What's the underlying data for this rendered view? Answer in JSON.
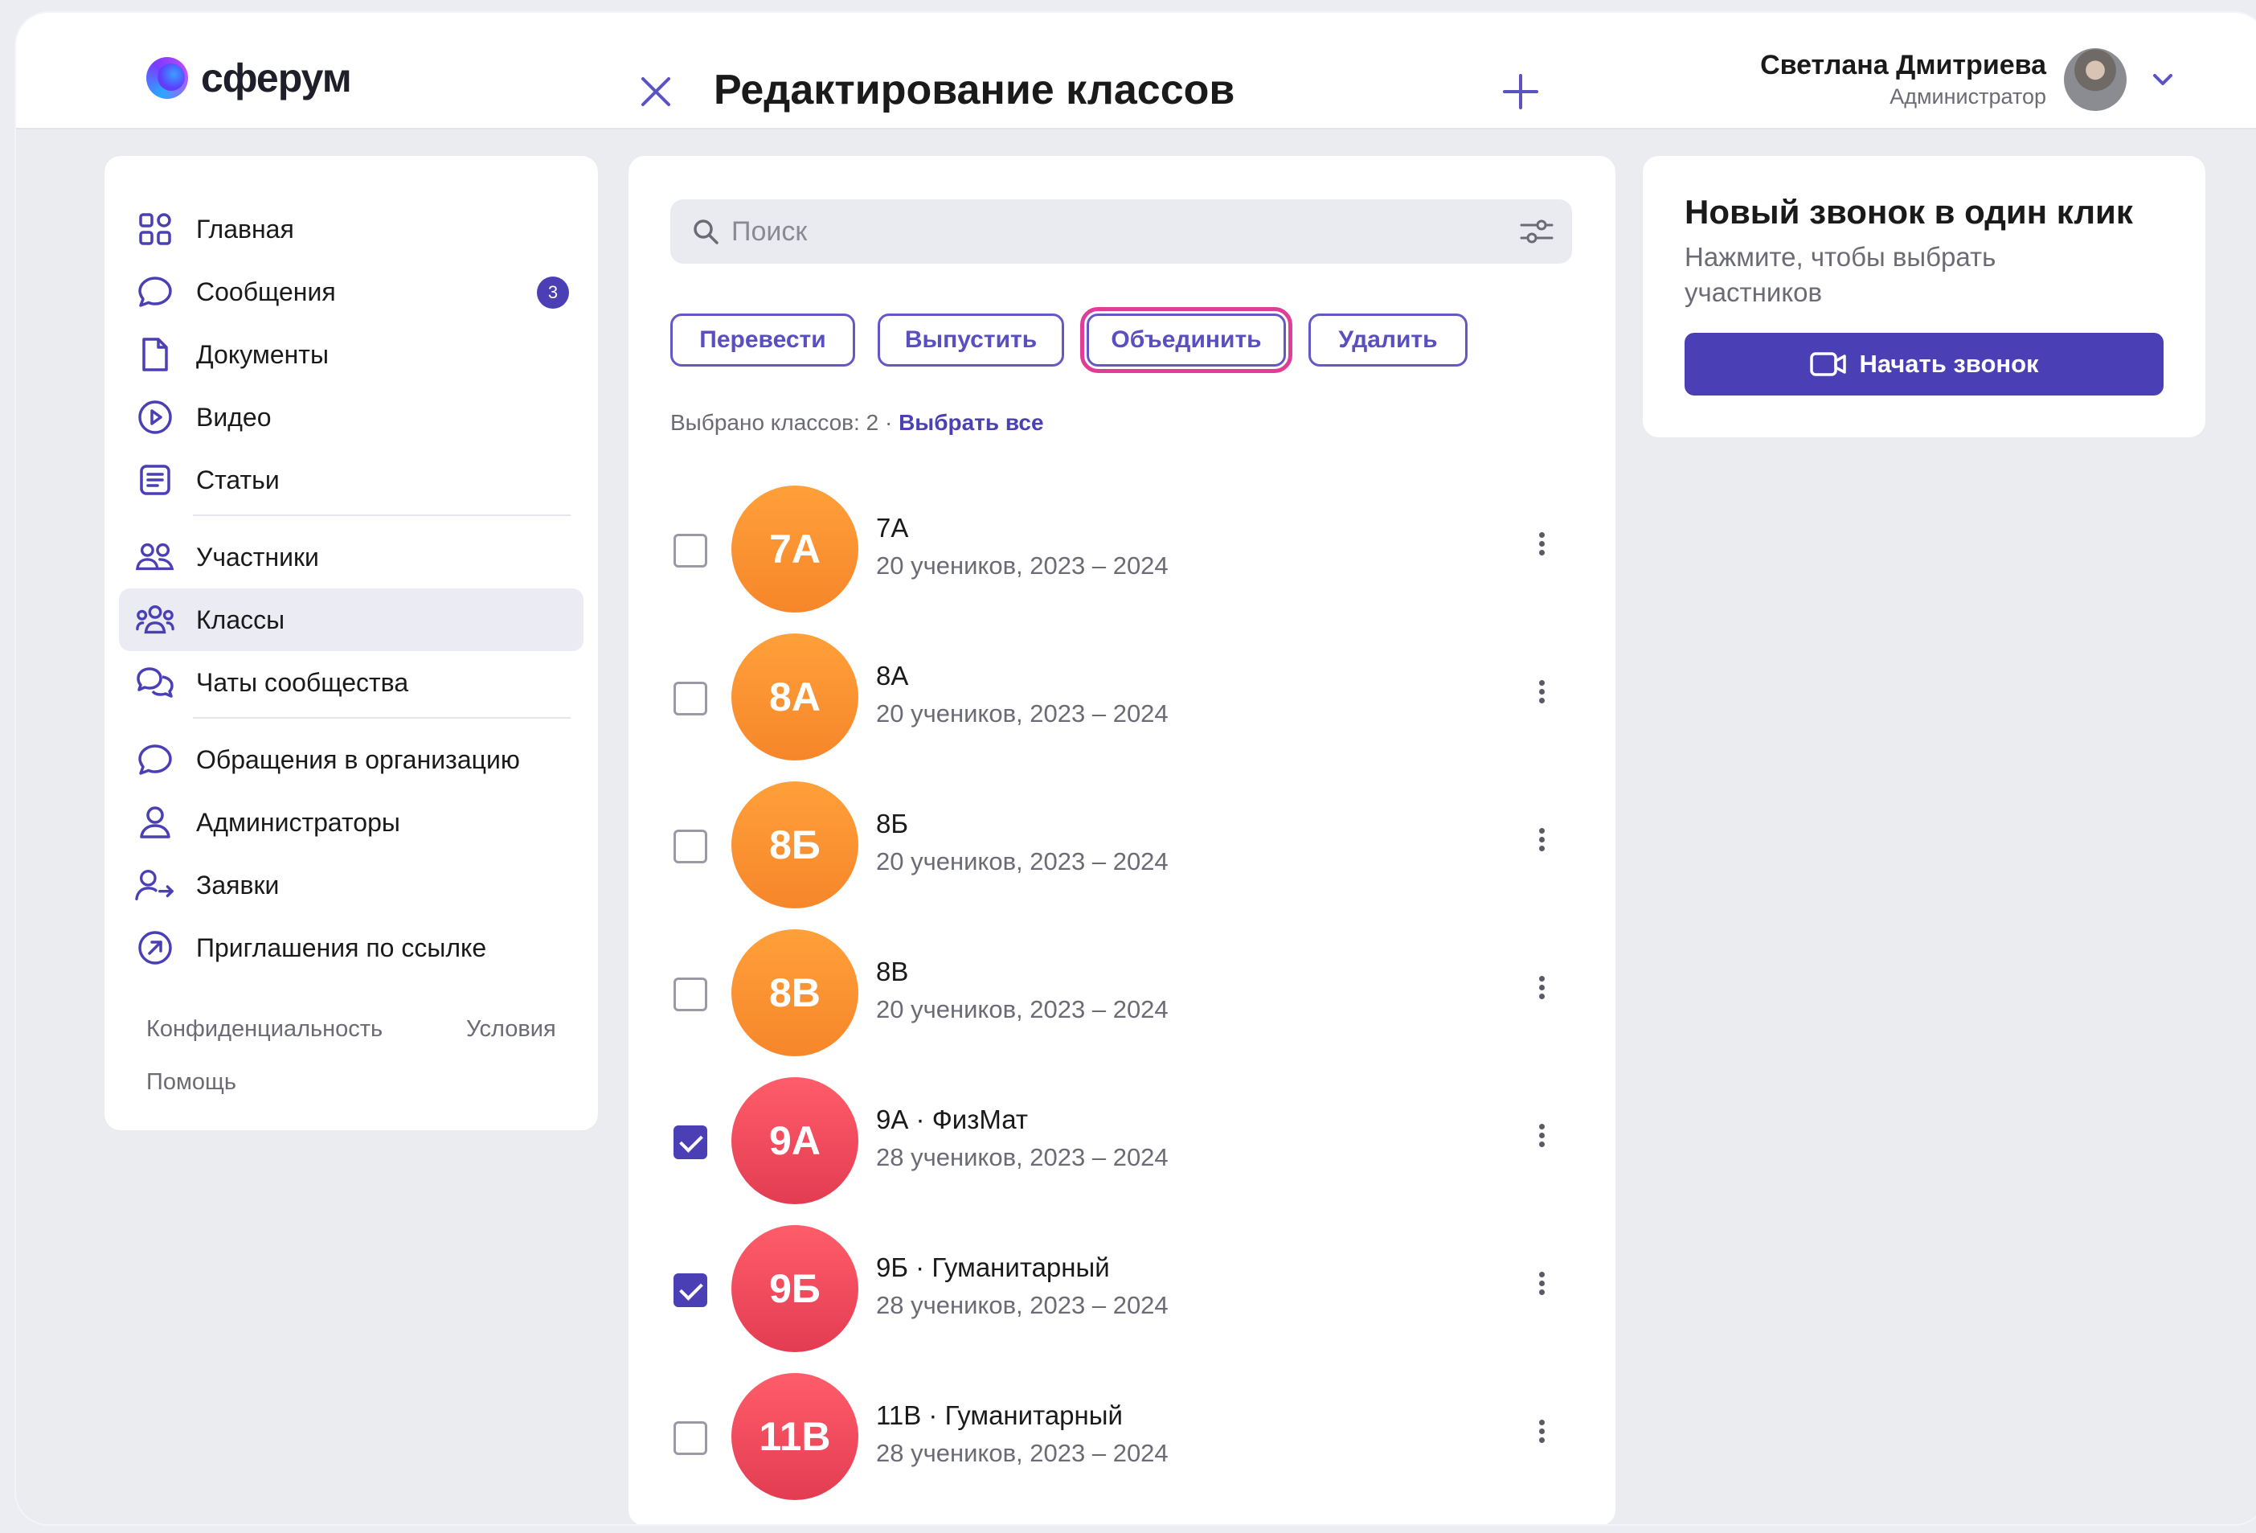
{
  "app": {
    "logo_text": "сферум"
  },
  "header": {
    "title": "Редактирование классов",
    "user_name": "Светлана Дмитриева",
    "user_role": "Администратор"
  },
  "sidebar": {
    "items": [
      {
        "label": "Главная",
        "icon": "grid-icon"
      },
      {
        "label": "Сообщения",
        "icon": "chat-bubble-icon",
        "badge": "3"
      },
      {
        "label": "Документы",
        "icon": "document-icon"
      },
      {
        "label": "Видео",
        "icon": "play-circle-icon"
      },
      {
        "label": "Статьи",
        "icon": "article-icon"
      },
      {
        "label": "Участники",
        "icon": "people-icon"
      },
      {
        "label": "Классы",
        "icon": "group-icon",
        "active": true
      },
      {
        "label": "Чаты сообщества",
        "icon": "chats-icon"
      },
      {
        "label": "Обращения в организацию",
        "icon": "chat-bubble-icon"
      },
      {
        "label": "Администраторы",
        "icon": "user-icon"
      },
      {
        "label": "Заявки",
        "icon": "user-arrow-icon"
      },
      {
        "label": "Приглашения по ссылке",
        "icon": "link-arrow-icon"
      }
    ],
    "footer": {
      "privacy": "Конфиденциальность",
      "terms": "Условия",
      "help": "Помощь"
    }
  },
  "main": {
    "search_placeholder": "Поиск",
    "actions": {
      "transfer": "Перевести",
      "graduate": "Выпустить",
      "merge": "Объединить",
      "delete": "Удалить"
    },
    "selected_text": "Выбрано классов: 2 ·",
    "select_all": "Выбрать все",
    "classes": [
      {
        "badge": "7А",
        "name": "7А",
        "meta": "20 учеников, 2023 – 2024",
        "checked": false,
        "color": "orange"
      },
      {
        "badge": "8А",
        "name": "8А",
        "meta": "20 учеников, 2023 – 2024",
        "checked": false,
        "color": "orange"
      },
      {
        "badge": "8Б",
        "name": "8Б",
        "meta": "20 учеников, 2023 – 2024",
        "checked": false,
        "color": "orange"
      },
      {
        "badge": "8В",
        "name": "8В",
        "meta": "20 учеников, 2023 – 2024",
        "checked": false,
        "color": "orange"
      },
      {
        "badge": "9А",
        "name": "9А · ФизМат",
        "meta": "28 учеников, 2023 – 2024",
        "checked": true,
        "color": "red"
      },
      {
        "badge": "9Б",
        "name": "9Б · Гуманитарный",
        "meta": "28 учеников, 2023 – 2024",
        "checked": true,
        "color": "red"
      },
      {
        "badge": "11В",
        "name": "11В · Гуманитарный",
        "meta": "28 учеников, 2023 – 2024",
        "checked": false,
        "color": "red"
      }
    ]
  },
  "call_card": {
    "title": "Новый звонок в один клик",
    "subtitle": "Нажмите, чтобы выбрать участников",
    "button": "Начать звонок"
  },
  "colors": {
    "accent": "#4a3fb5",
    "highlight": "#e13d97",
    "orange": "#f7902f",
    "red": "#e8485a"
  }
}
